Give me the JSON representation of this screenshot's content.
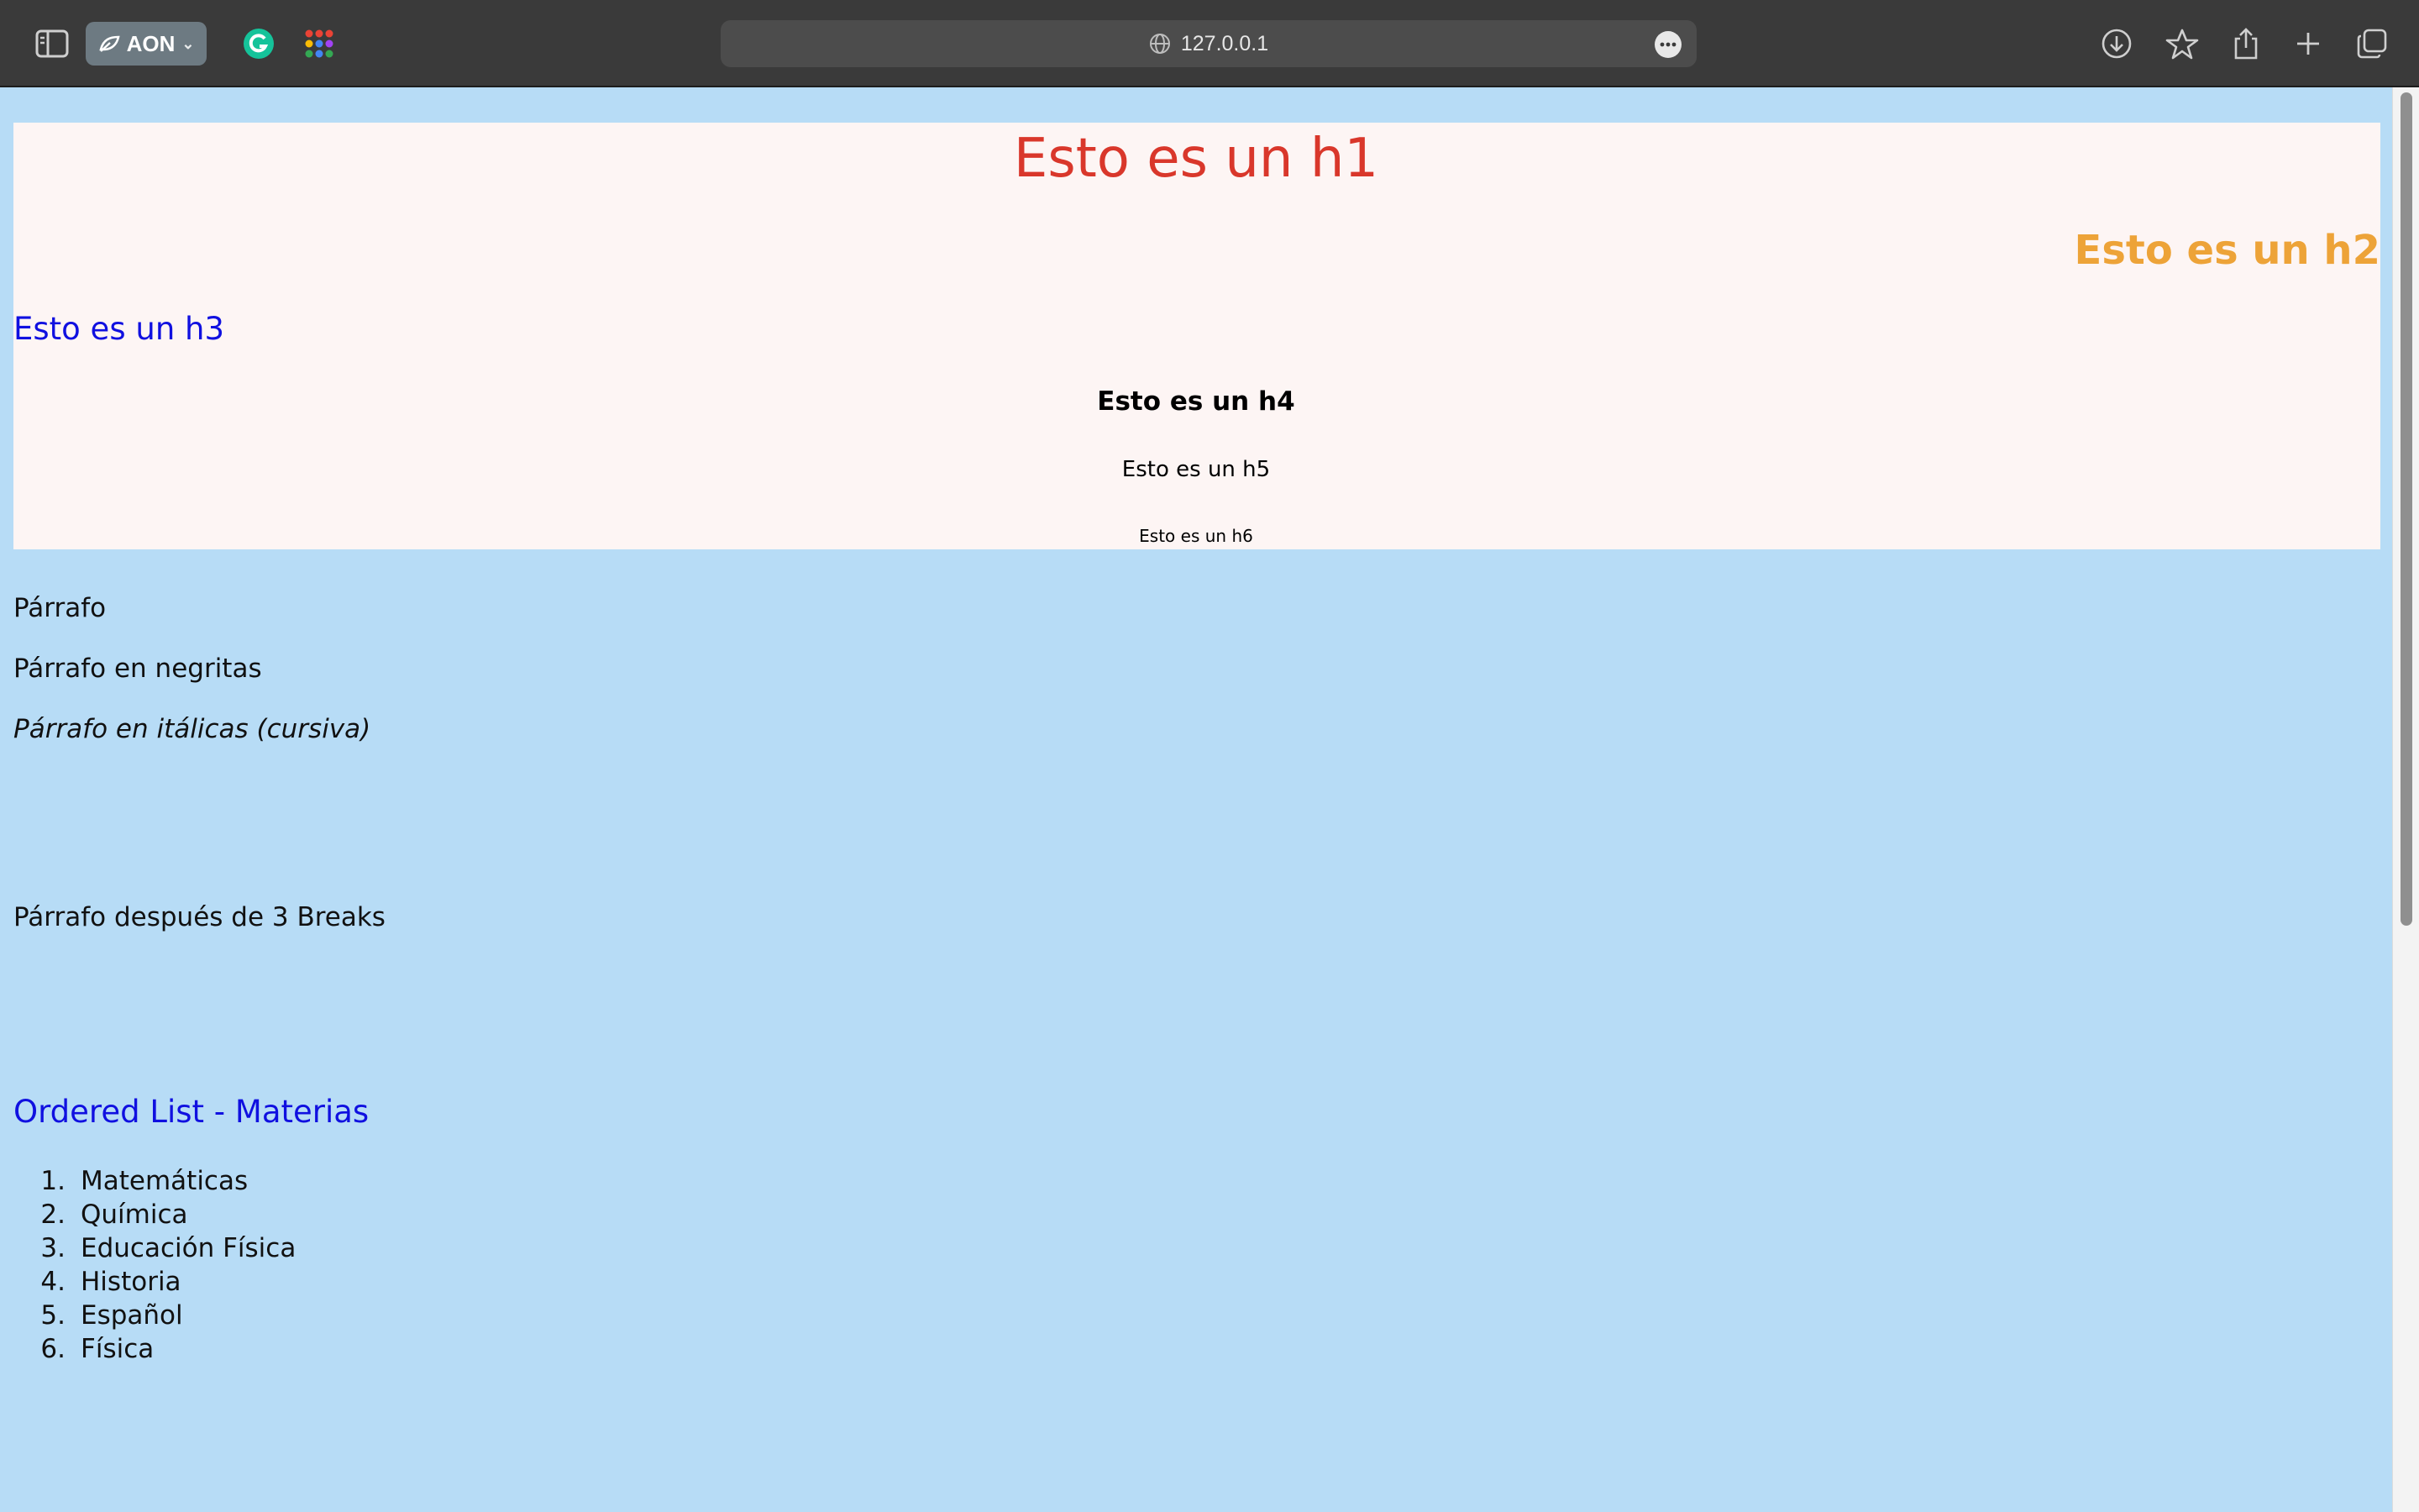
{
  "browser": {
    "profile_label": "AON",
    "address": "127.0.0.1"
  },
  "page": {
    "h1": "Esto es un h1",
    "h2": "Esto es un h2",
    "h3": "Esto es un h3",
    "h4": "Esto es un h4",
    "h5": "Esto es un h5",
    "h6": "Esto es un h6",
    "paragraph": "Párrafo",
    "paragraph_bold": "Párrafo en negritas",
    "paragraph_italic": "Párrafo en itálicas (cursiva)",
    "paragraph_after_breaks": "Párrafo después de 3 Breaks",
    "list_title": "Ordered List - Materias",
    "list_items": [
      {
        "num": "1.",
        "label": "Matemáticas"
      },
      {
        "num": "2.",
        "label": "Química"
      },
      {
        "num": "3.",
        "label": "Educación Física"
      },
      {
        "num": "4.",
        "label": "Historia"
      },
      {
        "num": "5.",
        "label": "Español"
      },
      {
        "num": "6.",
        "label": "Física"
      }
    ]
  },
  "colors": {
    "page_background": "#b7dcf6",
    "heading_box_background": "#fdf5f4",
    "h1": "#d9372b",
    "h2": "#eda338",
    "h3": "#1010e0",
    "list_title": "#1010e0"
  }
}
